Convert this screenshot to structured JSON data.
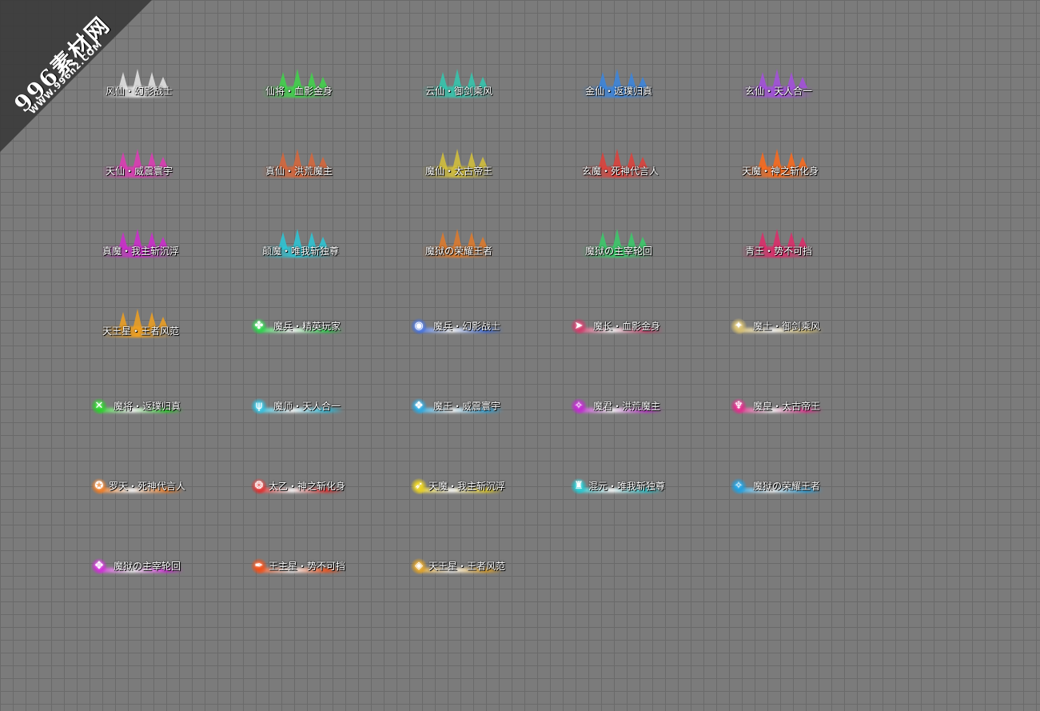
{
  "watermark": {
    "logo": "996素材网",
    "url": "WWW.996n2.COM"
  },
  "titles": [
    {
      "text": "风仙・幻影战士",
      "color": "#e6e6e6",
      "style": "badge"
    },
    {
      "text": "仙将・血影金身",
      "color": "#3fd64a",
      "style": "badge"
    },
    {
      "text": "云仙・御剑乘风",
      "color": "#33c9b0",
      "style": "badge"
    },
    {
      "text": "金仙・返璞归真",
      "color": "#3a86e0",
      "style": "badge"
    },
    {
      "text": "玄仙・天人合一",
      "color": "#a64fe0",
      "style": "badge"
    },
    {
      "text": "天仙・威震寰宇",
      "color": "#e03ab7",
      "style": "badge"
    },
    {
      "text": "真仙・洪荒魔主",
      "color": "#d9663a",
      "style": "badge"
    },
    {
      "text": "魔仙・太古帝王",
      "color": "#d6c23a",
      "style": "badge"
    },
    {
      "text": "玄魔・死神代言人",
      "color": "#e0403a",
      "style": "badge"
    },
    {
      "text": "天魔・神之斩化身",
      "color": "#ff6a1a",
      "style": "badge"
    },
    {
      "text": "真魔・我主斩沉浮",
      "color": "#d02ad0",
      "style": "badge"
    },
    {
      "text": "颠魔・唯我斩独尊",
      "color": "#2ac8d8",
      "style": "badge"
    },
    {
      "text": "魔狱の荣耀王者",
      "color": "#e07a2a",
      "style": "badge"
    },
    {
      "text": "魔狱の主宰轮回",
      "color": "#3acc6a",
      "style": "badge"
    },
    {
      "text": "青王・势不可挡",
      "color": "#e02a6a",
      "style": "badge"
    },
    {
      "text": "天王星・王者风范",
      "color": "#f0a020",
      "style": "badge"
    },
    {
      "text": "魔兵・精英玩家",
      "color": "#2ad44a",
      "style": "bar",
      "icon": "✤"
    },
    {
      "text": "魔兵・幻影战士",
      "color": "#3a6ae0",
      "style": "bar",
      "icon": "◉"
    },
    {
      "text": "魔长・血影金身",
      "color": "#d03a6a",
      "style": "bar",
      "icon": "➤"
    },
    {
      "text": "魔士・御剑乘风",
      "color": "#d8c070",
      "style": "bar",
      "icon": "✦"
    },
    {
      "text": "魔将・返璞归真",
      "color": "#2ad02a",
      "style": "bar",
      "icon": "✕"
    },
    {
      "text": "魔师・天人合一",
      "color": "#2ac0e0",
      "style": "bar",
      "icon": "ψ"
    },
    {
      "text": "魔王・威震寰宇",
      "color": "#2aa8e0",
      "style": "bar",
      "icon": "❖"
    },
    {
      "text": "魔君・洪荒魔主",
      "color": "#c02ad0",
      "style": "bar",
      "icon": "✧"
    },
    {
      "text": "魔皇・太古帝王",
      "color": "#e02a8a",
      "style": "bar",
      "icon": "♆"
    },
    {
      "text": "罗天・死神代言人",
      "color": "#f07a20",
      "style": "bar",
      "icon": "✪"
    },
    {
      "text": "太乙・神之斩化身",
      "color": "#e02a2a",
      "style": "bar",
      "icon": "❂"
    },
    {
      "text": "天魔・我主斩沉浮",
      "color": "#e8d020",
      "style": "bar",
      "icon": "➶"
    },
    {
      "text": "混元・唯我斩独尊",
      "color": "#20c8d0",
      "style": "bar",
      "icon": "♜"
    },
    {
      "text": "魔狱の荣耀王者",
      "color": "#20a0e0",
      "style": "bar",
      "icon": "✧"
    },
    {
      "text": "魔狱の主宰轮回",
      "color": "#d02ad8",
      "style": "bar",
      "icon": "✥"
    },
    {
      "text": "王主星・势不可挡",
      "color": "#f0501a",
      "style": "bar",
      "icon": "✒"
    },
    {
      "text": "天王星・王者风范",
      "color": "#e0a020",
      "style": "bar",
      "icon": "◈"
    }
  ]
}
